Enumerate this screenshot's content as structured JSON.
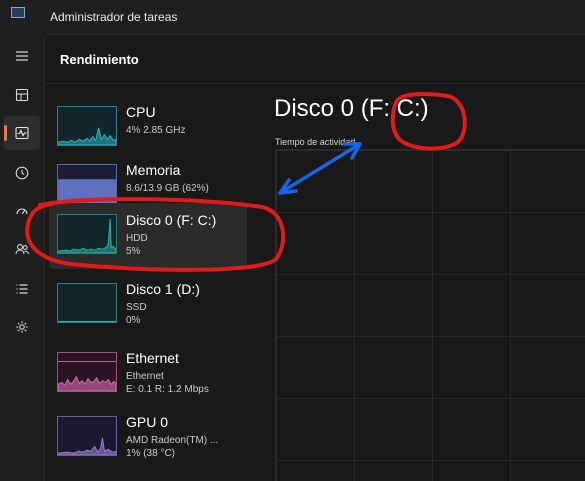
{
  "window": {
    "title": "Administrador de tareas"
  },
  "sidebar": {
    "items": [
      {
        "icon": "hamburger-menu-icon"
      },
      {
        "icon": "processes-icon"
      },
      {
        "icon": "performance-icon",
        "active": true
      },
      {
        "icon": "app-history-icon"
      },
      {
        "icon": "startup-apps-icon"
      },
      {
        "icon": "users-icon"
      },
      {
        "icon": "details-icon"
      },
      {
        "icon": "services-icon"
      }
    ]
  },
  "page": {
    "title": "Rendimiento"
  },
  "performance_list": [
    {
      "name": "CPU",
      "line1": "4% 2.85 GHz",
      "line2": "",
      "color": "#2fb3c4",
      "selected": false
    },
    {
      "name": "Memoria",
      "line1": "8.6/13.9 GB (62%)",
      "line2": "",
      "color": "#6b7fd7",
      "selected": false
    },
    {
      "name": "Disco 0 (F: C:)",
      "line1": "HDD",
      "line2": "5%",
      "color": "#2fb3a8",
      "selected": true
    },
    {
      "name": "Disco 1 (D:)",
      "line1": "SSD",
      "line2": "0%",
      "color": "#2fb3a8",
      "selected": false
    },
    {
      "name": "Ethernet",
      "line1": "Ethernet",
      "line2": "E: 0.1 R: 1.2 Mbps",
      "color": "#d86bb0",
      "selected": false
    },
    {
      "name": "GPU 0",
      "line1": "AMD Radeon(TM) ...",
      "line2": "1% (38 °C)",
      "color": "#9b7fd7",
      "selected": false
    }
  ],
  "detail": {
    "title": "Disco 0 (F: C:)",
    "graph_caption": "Tiempo de actividad"
  },
  "annotations": {
    "circle_color": "#e01b1b",
    "arrow_color": "#1565e8"
  }
}
